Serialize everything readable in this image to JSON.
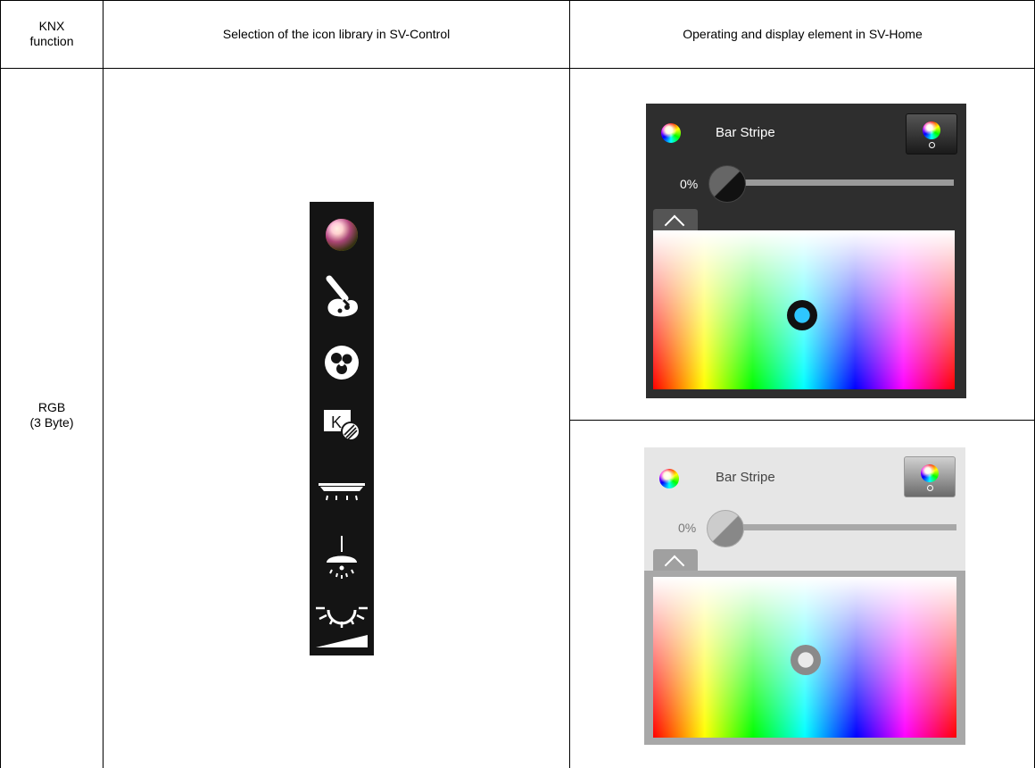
{
  "table": {
    "headers": {
      "col1": "KNX function",
      "col1_line1": "KNX",
      "col1_line2": "function",
      "col2": "Selection of the icon library in SV-Control",
      "col3": "Operating and display element in SV-Home"
    },
    "row": {
      "function_line1": "RGB",
      "function_line2": "(3 Byte)"
    }
  },
  "icon_library": {
    "icons": [
      "color-wheel-icon",
      "paint-brush-icon",
      "color-balls-icon",
      "kelvin-icon",
      "ceiling-light-icon",
      "pendant-lamp-icon",
      "sun-dimmer-icon"
    ]
  },
  "widgets": {
    "dark": {
      "theme": "dark",
      "title": "Bar Stripe",
      "percent": "0%",
      "slider_value": 0
    },
    "light": {
      "theme": "light",
      "title": "Bar Stripe",
      "percent": "0%",
      "slider_value": 0
    }
  },
  "colors": {
    "dark_bg": "#2e2e2e",
    "light_bg": "#e6e6e6",
    "strip_bg": "#141414"
  }
}
